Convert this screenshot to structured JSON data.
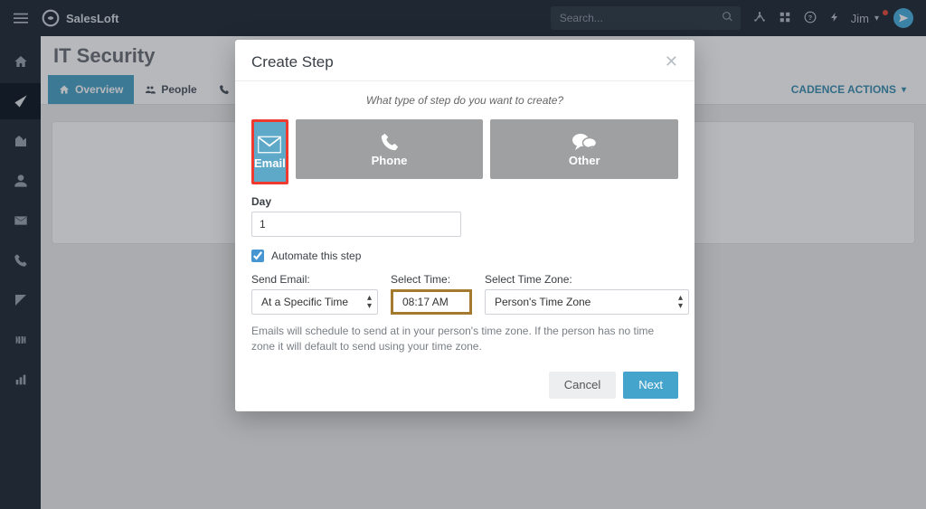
{
  "brand": {
    "name": "SalesLoft"
  },
  "topbar": {
    "search_placeholder": "Search...",
    "user_name": "Jim"
  },
  "page": {
    "title": "IT Security",
    "tabs": {
      "overview": "Overview",
      "people": "People",
      "calls": "Calls"
    },
    "cadence_actions_label": "CADENCE ACTIONS"
  },
  "modal": {
    "title": "Create Step",
    "prompt": "What type of step do you want to create?",
    "step_types": {
      "email": "Email",
      "phone": "Phone",
      "other": "Other"
    },
    "day_label": "Day",
    "day_value": "1",
    "automate_label": "Automate this step",
    "send_email_label": "Send Email:",
    "send_email_value": "At a Specific Time",
    "select_time_label": "Select Time:",
    "select_time_value": "08:17 AM",
    "select_tz_label": "Select Time Zone:",
    "select_tz_value": "Person's Time Zone",
    "helper_text": "Emails will schedule to send at in your person's time zone. If the person has no time zone it will default to send using your time zone.",
    "cancel_label": "Cancel",
    "next_label": "Next"
  }
}
